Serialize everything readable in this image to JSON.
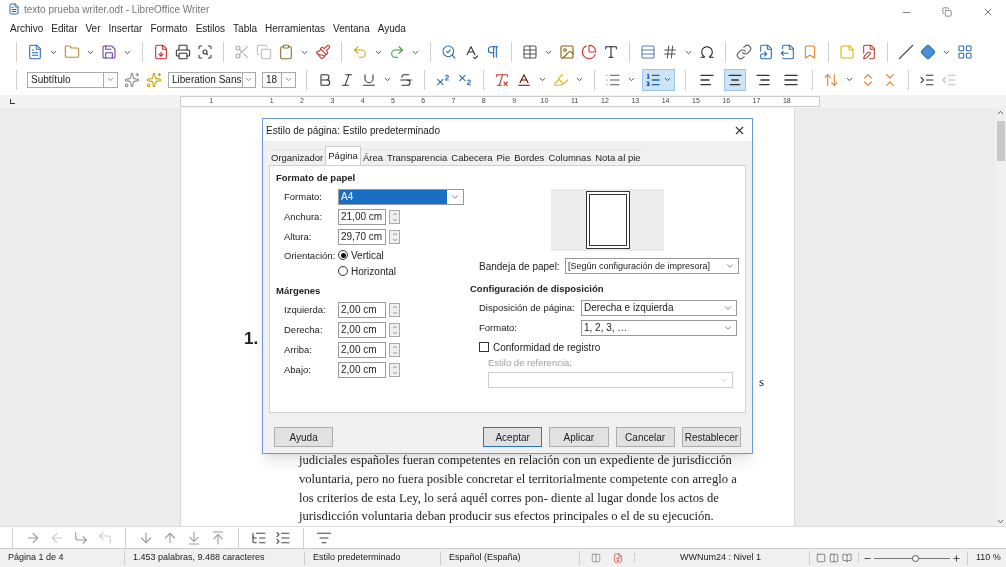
{
  "window": {
    "title": "texto prueba writer.odt - LibreOffice Writer"
  },
  "menu": [
    "Archivo",
    "Editar",
    "Ver",
    "Insertar",
    "Formato",
    "Estilos",
    "Tabla",
    "Herramientas",
    "Ventana",
    "Ayuda"
  ],
  "formatting": {
    "paragraph_style": "Subtítulo",
    "font_name": "Liberation Sans",
    "font_size": "18",
    "numbered_list": true,
    "align": [
      {
        "selected": false
      },
      {
        "selected": true
      },
      {
        "selected": false
      },
      {
        "selected": false
      }
    ]
  },
  "ruler": [
    "1",
    "1",
    "2",
    "3",
    "4",
    "5",
    "6",
    "7",
    "8",
    "9",
    "10",
    "11",
    "12",
    "13",
    "14",
    "15",
    "16",
    "17",
    "18"
  ],
  "document": {
    "heading_number": "1.",
    "fragment": "s",
    "lines": [
      "judiciales españoles fueran competentes en relación con un expediente de jurisdicción",
      "voluntaria, pero no fuera posible concretar el territorialmente competente con arreglo a",
      "los criterios de esta Ley, lo será aquél corres pon- diente al lugar donde los actos de",
      "jurisdicción voluntaria deban producir sus efectos principales o el de su ejecución."
    ]
  },
  "dialog": {
    "title": "Estilo de página: Estilo predeterminado",
    "tabs": [
      {
        "label": "Organizador",
        "selected": false
      },
      {
        "label": "Página",
        "selected": true
      },
      {
        "label": "Área",
        "selected": false
      },
      {
        "label": "Transparencia",
        "selected": false
      },
      {
        "label": "Cabecera",
        "selected": false
      },
      {
        "label": "Pie",
        "selected": false
      },
      {
        "label": "Bordes",
        "selected": false
      },
      {
        "label": "Columnas",
        "selected": false
      },
      {
        "label": "Nota al pie",
        "selected": false
      }
    ],
    "paper": {
      "heading": "Formato de papel",
      "fields": [
        {
          "kind": "dropdown",
          "label": "Formato:",
          "value": "A4"
        },
        {
          "kind": "spin",
          "label": "Anchura:",
          "value": "21,00 cm"
        },
        {
          "kind": "spin",
          "label": "Altura:",
          "value": "29,70 cm"
        }
      ],
      "orientation": {
        "label": "Orientación:",
        "options": [
          {
            "label": "Vertical",
            "selected": true
          },
          {
            "label": "Horizontal",
            "selected": false
          }
        ]
      }
    },
    "paper_tray": {
      "label": "Bandeja de papel:",
      "value": "[Según configuración de impresora]"
    },
    "margins": {
      "heading": "Márgenes",
      "fields": [
        {
          "label": "Izquierda:",
          "value": "2,00 cm"
        },
        {
          "label": "Derecha:",
          "value": "2,00 cm"
        },
        {
          "label": "Arriba:",
          "value": "2,00 cm"
        },
        {
          "label": "Abajo:",
          "value": "2,00 cm"
        }
      ]
    },
    "layout": {
      "heading": "Configuración de disposición",
      "fields": [
        {
          "label": "Disposición de página:",
          "value": "Derecha e izquierda"
        },
        {
          "label": "Formato:",
          "value": "1, 2, 3, …"
        }
      ],
      "register": {
        "label": "Conformidad de registro",
        "checked": false
      },
      "reference": {
        "label": "Estilo de referencia:",
        "disabled": true
      }
    },
    "buttons": [
      {
        "label": "Ayuda",
        "default": false
      },
      {
        "label": "Aceptar",
        "default": true
      },
      {
        "label": "Aplicar",
        "default": false
      },
      {
        "label": "Cancelar",
        "default": false
      },
      {
        "label": "Restablecer",
        "default": false
      }
    ]
  },
  "status_bar": {
    "page": "Página 1 de 4",
    "words": "1.453 palabras, 9.488 caracteres",
    "page_style": "Estilo predeterminado",
    "language": "Español (España)",
    "list_level": "WWNum24 : Nivel 1",
    "zoom": "110 %",
    "zoom_slider": {
      "level": 0.55
    }
  }
}
